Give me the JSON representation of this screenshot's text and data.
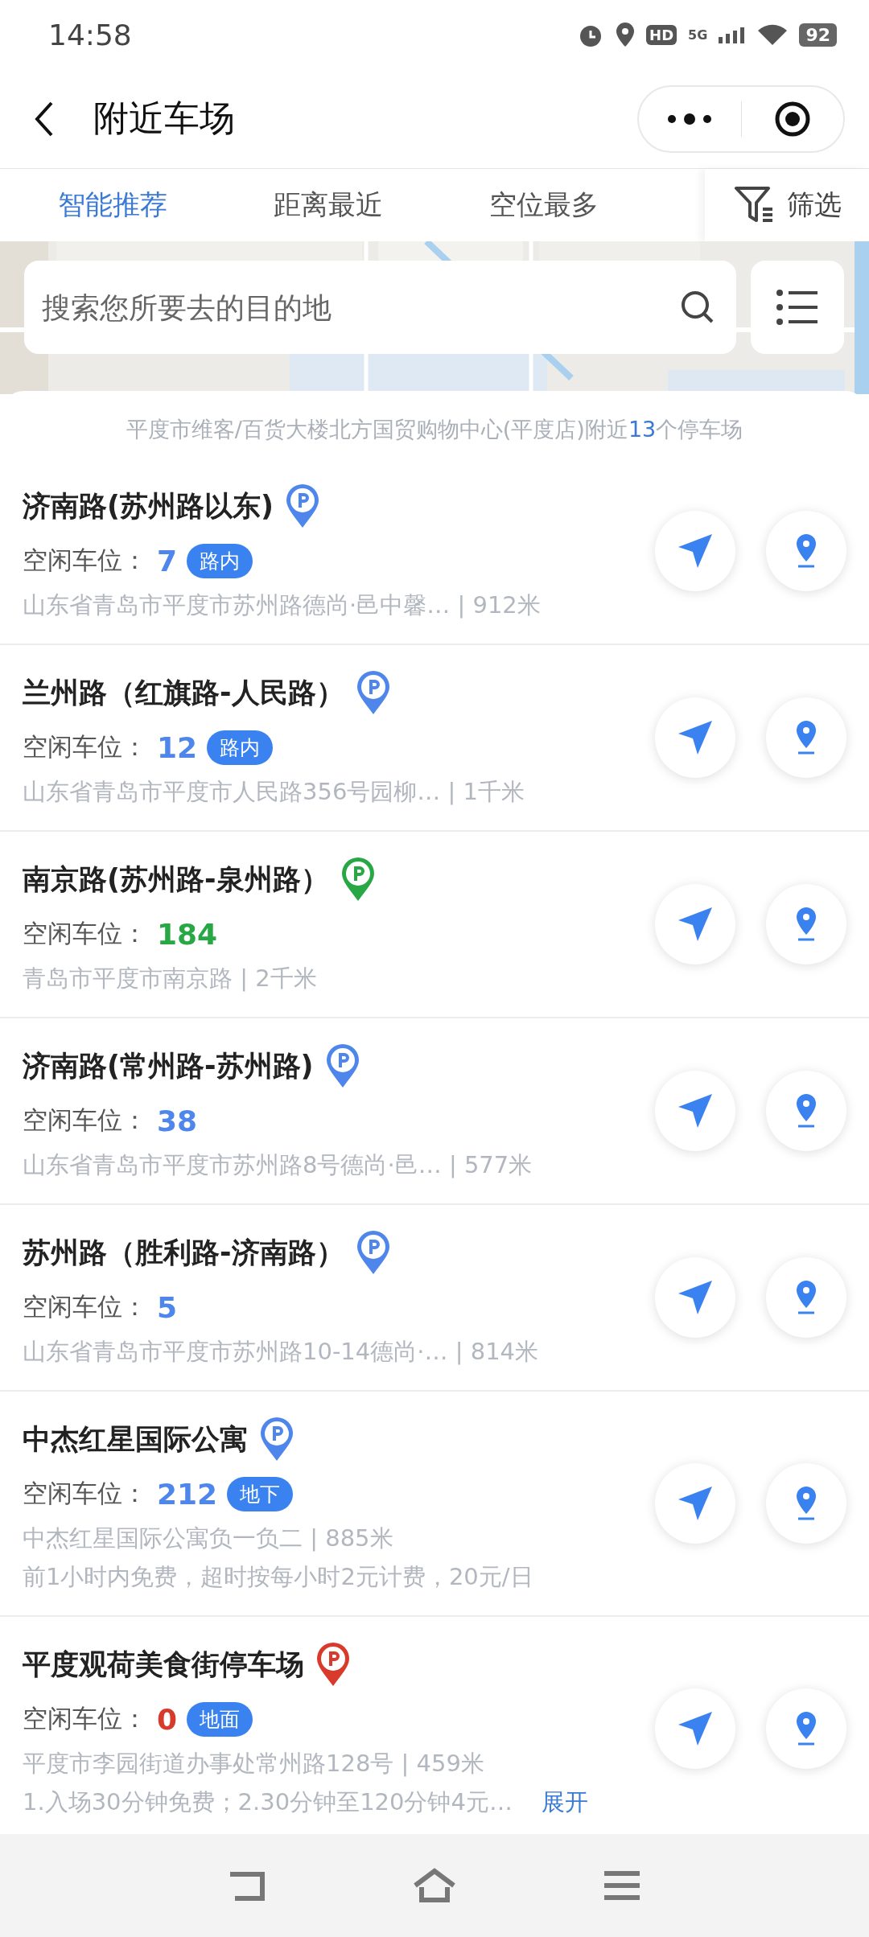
{
  "status_bar": {
    "time": "14:58",
    "hd": "HD",
    "network": "5G",
    "battery": "92"
  },
  "header": {
    "title": "附近车场"
  },
  "tabs": [
    {
      "label": "智能推荐",
      "selected": true
    },
    {
      "label": "距离最近",
      "selected": false
    },
    {
      "label": "空位最多",
      "selected": false
    }
  ],
  "filter": {
    "label": "筛选"
  },
  "search": {
    "placeholder": "搜索您所要去的目的地"
  },
  "summary": {
    "text": "平度市维客/百货大楼北方国贸购物中心(平度店)附近",
    "count": "13",
    "suffix": "个停车场"
  },
  "lots": [
    {
      "name": "济南路(苏州路以东)",
      "color": "#4f86ec",
      "label": "空闲车位：",
      "count": "7",
      "tag": "路内",
      "address": "山东省青岛市平度市苏州路德尚·邑中馨… | 912米"
    },
    {
      "name": "兰州路（红旗路-人民路）",
      "color": "#4f86ec",
      "label": "空闲车位：",
      "count": "12",
      "tag": "路内",
      "address": "山东省青岛市平度市人民路356号园柳…   | 1千米"
    },
    {
      "name": "南京路(苏州路-泉州路）",
      "color": "#27a844",
      "label": "空闲车位：",
      "count": "184",
      "address": "青岛市平度市南京路 | 2千米"
    },
    {
      "name": "济南路(常州路-苏州路)",
      "color": "#4f86ec",
      "label": "空闲车位：",
      "count": "38",
      "address": "山东省青岛市平度市苏州路8号德尚·邑…  | 577米"
    },
    {
      "name": "苏州路（胜利路-济南路）",
      "color": "#4f86ec",
      "label": "空闲车位：",
      "count": "5",
      "address": "山东省青岛市平度市苏州路10-14德尚·…  | 814米"
    },
    {
      "name": "中杰红星国际公寓",
      "color": "#4f86ec",
      "label": "空闲车位：",
      "count": "212",
      "tag": "地下",
      "address": "中杰红星国际公寓负一负二 | 885米",
      "fee": "前1小时内免费，超时按每小时2元计费，20元/日"
    },
    {
      "name": "平度观荷美食街停车场",
      "color": "#d83a2c",
      "label": "空闲车位：",
      "count": "0",
      "tag": "地面",
      "address": "平度市李园街道办事处常州路128号 | 459米",
      "fee": "1.入场30分钟免费；2.30分钟至120分钟4元…",
      "more": "展开"
    }
  ]
}
